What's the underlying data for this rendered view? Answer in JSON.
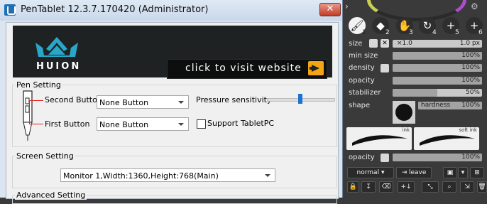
{
  "window": {
    "title": "PenTablet 12.3.7.170420 (Administrator)",
    "close_glyph": "✕"
  },
  "banner": {
    "logo_text": "HUION",
    "visit_text": "click to visit website"
  },
  "pen_setting": {
    "group_label": "Pen Setting",
    "second_button_label": "Second Button",
    "second_button_value": "None Button",
    "first_button_label": "First Button",
    "first_button_value": "None Button",
    "pressure_label": "Pressure sensitivity",
    "pressure_level": 0.5,
    "support_tabletpc_label": "Support TabletPC",
    "support_tabletpc_checked": false
  },
  "screen_setting": {
    "group_label": "Screen Setting",
    "monitor_value": "Monitor 1,Width:1360,Height:768(Main)"
  },
  "advanced_setting": {
    "group_label": "Advanced Setting"
  },
  "brush_panel": {
    "tools": [
      {
        "icon": "brush-icon",
        "glyph": "🖌",
        "num": "1",
        "active": true
      },
      {
        "icon": "eraser-icon",
        "glyph": "◆",
        "num": "2",
        "active": false
      },
      {
        "icon": "hand-icon",
        "glyph": "✋",
        "num": "3",
        "active": false
      },
      {
        "icon": "rotate-icon",
        "glyph": "↻",
        "num": "4",
        "active": false
      },
      {
        "icon": "plus-icon",
        "glyph": "+",
        "num": "5",
        "active": false
      },
      {
        "icon": "plus-icon",
        "glyph": "+",
        "num": "6",
        "active": false
      }
    ],
    "size_label": "size",
    "size_multiplier": "×1.0",
    "size_px": "1.0 px",
    "min_size_label": "min size",
    "min_size_value": "100%",
    "density_label": "density",
    "density_value": "100%",
    "opacity_label": "opacity",
    "opacity_value": "100%",
    "stabilizer_label": "stabilizer",
    "stabilizer_value": "50%",
    "stabilizer_level": 0.5,
    "shape_label": "shape",
    "hardness_label": "hardness",
    "hardness_value": "100%",
    "brush_ink_label": "ink",
    "brush_softink_label": "soft ink",
    "layer_opacity_label": "opacity",
    "layer_opacity_value": "100%",
    "blend_mode": "normal",
    "leave_label": "leave",
    "colors": {
      "panel_bg": "#3a3a3a",
      "bar_bg": "#c9c9c9",
      "bar_fill": "#a3a3a3"
    }
  }
}
